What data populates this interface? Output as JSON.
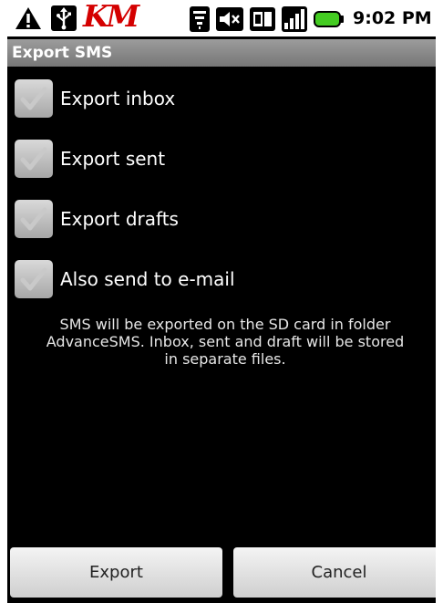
{
  "status_bar": {
    "carrier_logo": "KM",
    "time": "9:02 PM",
    "icons": [
      "warning-icon",
      "usb-icon",
      "km-icon",
      "wifi-icon",
      "mute-icon",
      "sim-icon",
      "signal-icon",
      "battery-icon"
    ]
  },
  "title": "Export SMS",
  "options": [
    {
      "label": "Export inbox",
      "checked": true
    },
    {
      "label": "Export sent",
      "checked": true
    },
    {
      "label": "Export drafts",
      "checked": true
    },
    {
      "label": "Also send to e-mail",
      "checked": true
    }
  ],
  "info_lines": [
    "SMS will be exported on the SD card in folder",
    "AdvanceSMS. Inbox, sent and draft will be stored",
    "in separate files."
  ],
  "buttons": {
    "export": "Export",
    "cancel": "Cancel"
  },
  "colors": {
    "background": "#000000",
    "title_bar": "#8a8a8a",
    "status_bar": "#ffffff",
    "carrier_logo": "#d40000",
    "battery": "#44cc22"
  }
}
